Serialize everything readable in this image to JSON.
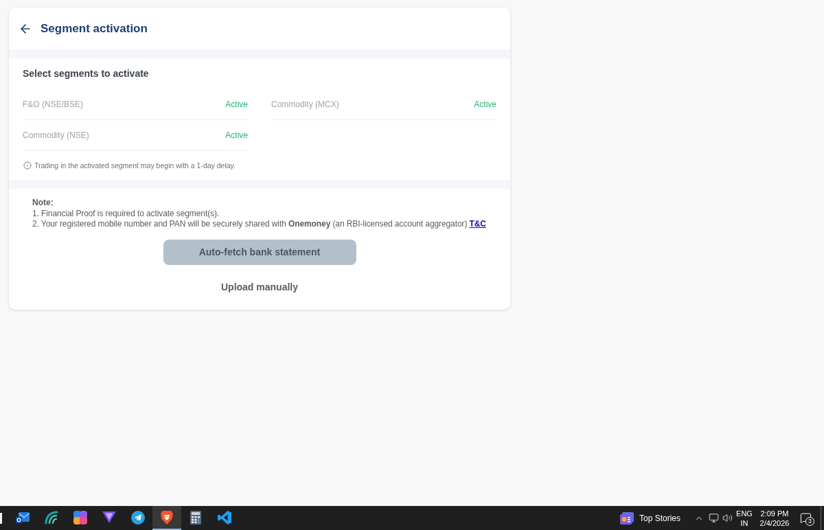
{
  "header": {
    "title": "Segment activation"
  },
  "segments": {
    "heading": "Select segments to activate",
    "items": [
      {
        "name": "F&O (NSE/BSE)",
        "status": "Active"
      },
      {
        "name": "Commodity (MCX)",
        "status": "Active"
      },
      {
        "name": "Commodity (NSE)",
        "status": "Active"
      }
    ],
    "info": "Trading in the activated segment may begin with a 1-day delay."
  },
  "note": {
    "heading": "Note:",
    "lines": [
      {
        "text": "1. Financial Proof is required to activate segment(s)."
      },
      {
        "text": "2. Your registered mobile number and PAN will be securely shared with **Onemoney** (an RBI-licensed account aggregator)",
        "link": "T&C"
      }
    ]
  },
  "buttons": [
    {
      "kind": "filled",
      "label": "Auto-fetch bank statement",
      "disabled": true
    },
    {
      "kind": "text",
      "label": "Upload manually",
      "disabled": false
    }
  ],
  "taskbar": {
    "apps": [
      {
        "kind": "partial",
        "selected": false
      },
      {
        "kind": "mail",
        "selected": false
      },
      {
        "kind": "wave",
        "selected": false
      },
      {
        "kind": "colorful",
        "selected": false
      },
      {
        "kind": "triangle",
        "selected": false
      },
      {
        "kind": "plane",
        "selected": false
      },
      {
        "kind": "lion",
        "selected": true
      },
      {
        "kind": "calculator",
        "selected": false
      },
      {
        "kind": "ribbon",
        "selected": false
      }
    ],
    "news": "Top Stories",
    "language": "ENG",
    "region": "IN",
    "time": "2:09 PM",
    "date": "2/4/2026",
    "notification_count": "3"
  }
}
